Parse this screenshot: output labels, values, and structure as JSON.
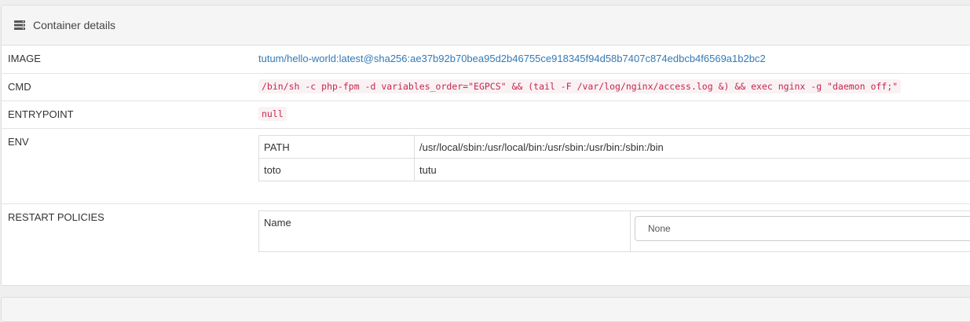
{
  "panel": {
    "title": "Container details",
    "icon": "server-icon"
  },
  "rows": {
    "image": {
      "label": "IMAGE",
      "value": "tutum/hello-world:latest@sha256:ae37b92b70bea95d2b46755ce918345f94d58b7407c874edbcb4f6569a1b2bc2"
    },
    "cmd": {
      "label": "CMD",
      "value": "/bin/sh -c php-fpm -d variables_order=\"EGPCS\" && (tail -F /var/log/nginx/access.log &) && exec nginx -g \"daemon off;\""
    },
    "entrypoint": {
      "label": "ENTRYPOINT",
      "value": "null"
    },
    "env": {
      "label": "ENV",
      "items": [
        {
          "key": "PATH",
          "value": "/usr/local/sbin:/usr/local/bin:/usr/sbin:/usr/bin:/sbin:/bin"
        },
        {
          "key": "toto",
          "value": "tutu"
        }
      ]
    },
    "restart_policies": {
      "label": "RESTART POLICIES",
      "name_label": "Name",
      "selected": "None"
    }
  },
  "colors": {
    "link": "#337ab7",
    "code": "#c7254e",
    "code_bg": "#f9f2f4",
    "heading_bg": "#f5f5f5"
  }
}
